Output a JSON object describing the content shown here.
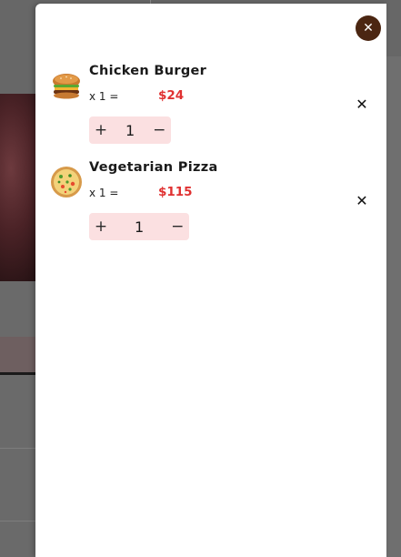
{
  "cart": {
    "close_icon": "close-icon",
    "items": [
      {
        "name": "Chicken Burger",
        "qty_text": "x 1 =",
        "price": "$24",
        "quantity": "1",
        "image": "burger-thumbnail",
        "increase_icon": "plus-icon",
        "decrease_icon": "minus-icon",
        "remove_icon": "close-icon"
      },
      {
        "name": "Vegetarian Pizza",
        "qty_text": "x 1 =",
        "price": "$115",
        "quantity": "1",
        "image": "pizza-thumbnail",
        "increase_icon": "plus-icon",
        "decrease_icon": "minus-icon",
        "remove_icon": "close-icon"
      }
    ]
  },
  "colors": {
    "accent_dark_brown": "#4b2612",
    "price_red": "#e03131",
    "stepper_bg": "#fbe0e1",
    "overlay_gray": "#6b6b6b"
  }
}
